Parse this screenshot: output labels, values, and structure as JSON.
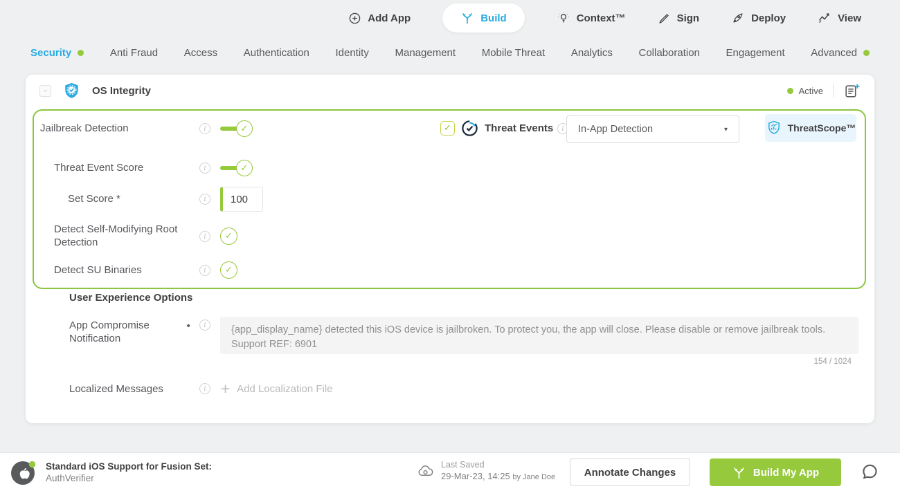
{
  "topnav": {
    "items": [
      {
        "label": "Add App"
      },
      {
        "label": "Build"
      },
      {
        "label": "Context™"
      },
      {
        "label": "Sign"
      },
      {
        "label": "Deploy"
      },
      {
        "label": "View"
      }
    ]
  },
  "tabs": {
    "items": [
      {
        "label": "Security",
        "active": true,
        "dot": true
      },
      {
        "label": "Anti Fraud"
      },
      {
        "label": "Access"
      },
      {
        "label": "Authentication"
      },
      {
        "label": "Identity"
      },
      {
        "label": "Management"
      },
      {
        "label": "Mobile Threat"
      },
      {
        "label": "Analytics"
      },
      {
        "label": "Collaboration"
      },
      {
        "label": "Engagement"
      },
      {
        "label": "Advanced",
        "dot": true
      }
    ]
  },
  "card": {
    "title": "OS Integrity",
    "status": "Active",
    "jailbreak": {
      "label": "Jailbreak Detection"
    },
    "threat_events": {
      "label": "Threat Events",
      "dropdown_value": "In-App Detection",
      "threatscope_label": "ThreatScope™"
    },
    "threat_event_score": {
      "label": "Threat Event Score"
    },
    "set_score": {
      "label": "Set Score *",
      "value": "100"
    },
    "detect_self_modifying": {
      "label": "Detect Self-Modifying Root Detection"
    },
    "detect_su": {
      "label": "Detect SU Binaries"
    },
    "ux_heading": "User Experience Options",
    "app_compromise": {
      "label": "App Compromise Notification",
      "message": "{app_display_name} detected this iOS device is jailbroken. To protect you, the app will close. Please disable or remove jailbreak tools. Support REF: 6901",
      "counter": "154 / 1024"
    },
    "localized": {
      "label": "Localized Messages",
      "add_file_label": "Add Localization File"
    }
  },
  "footer": {
    "fusion_title": "Standard iOS Support for Fusion Set:",
    "fusion_name": "AuthVerifier",
    "last_saved_label": "Last Saved",
    "last_saved_value": "29-Mar-23, 14:25",
    "last_saved_by": "by Jane Doe",
    "annotate_label": "Annotate Changes",
    "build_label": "Build My App"
  },
  "icons": {
    "check": "✓",
    "caret_down": "▾",
    "plus": "+",
    "minus": "–",
    "bullet": "•",
    "info": "i"
  },
  "colors": {
    "accent_blue": "#29abe2",
    "accent_green": "#97c93d",
    "region_border_green": "#8cc63f"
  }
}
